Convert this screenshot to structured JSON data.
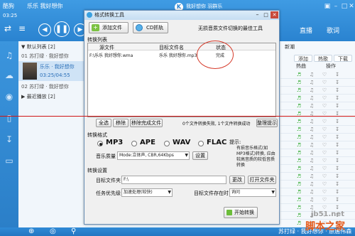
{
  "player": {
    "brand": "酷狗",
    "now_playing": "乐乐  我好想你",
    "time": "03:25",
    "user": "我好想你 羽群乐",
    "tabs": [
      "直播",
      "歌词"
    ],
    "nav_icons": [
      "prev-icon",
      "pause-icon",
      "next-icon"
    ],
    "left_list": {
      "group1": "默认列表",
      "group1_count": "[2]",
      "item1": "01  苏打绿 · 我好想你",
      "playing_title": "乐乐 · 我好想你",
      "playing_time": "03:25/04:55",
      "item2": "02  苏打绿 · 我好想你",
      "group2": "最近播放",
      "group2_count": "[2]"
    },
    "right_panel": {
      "header": "新潮",
      "tabs": [
        "添加",
        "热歌",
        "下载"
      ],
      "cols": [
        "热曲",
        "操作"
      ]
    },
    "bottom_now_playing": "苏打绿 · 我好想你 · 原唐伟森"
  },
  "dialog": {
    "title": "格式转换工具",
    "add_file": "添加文件",
    "cd_rip": "CD抓轨",
    "slogan": "无损音质文件切换的最佳工具",
    "list_section": "转换列表",
    "columns": [
      "源文件",
      "目标文件名",
      "状态"
    ],
    "rows": [
      {
        "source": "F:\\乐乐  我好想你.wma",
        "target": "乐乐  我好想你.mp3",
        "status": "完成"
      }
    ],
    "select_all": "全选",
    "remove": "移除",
    "remove_done": "移除完成文件",
    "summary": "0个文件转换失败, 1个文件转换成功",
    "sort_tips": "整理提示",
    "format_section": "转换格式",
    "formats": [
      "MP3",
      "APE",
      "WAV",
      "FLAC"
    ],
    "selected_format": "MP3",
    "quality_label": "音乐质量",
    "quality_value": "Mode:立体声, CBR,64Kbps",
    "settings_button": "设置",
    "tip_label": "提示:",
    "tip_text": "有损音乐格式(如MP3格式)转换, 应由较高音质的较低音质转换",
    "task_section": "转换设置",
    "target_folder_label": "目标文件夹",
    "target_folder_value": "F:\\",
    "change": "更改",
    "open_folder": "打开文件夹",
    "priority_label": "任务优先级",
    "priority_value": "加速处理(较快)",
    "exists_label": "目标文件存在时",
    "exists_value": "询问",
    "start": "开始转换"
  },
  "watermark": {
    "site": "jb51.net",
    "name": "脚本之家"
  },
  "colors": {
    "accent": "#2a83d0",
    "annotation": "#d01515"
  }
}
